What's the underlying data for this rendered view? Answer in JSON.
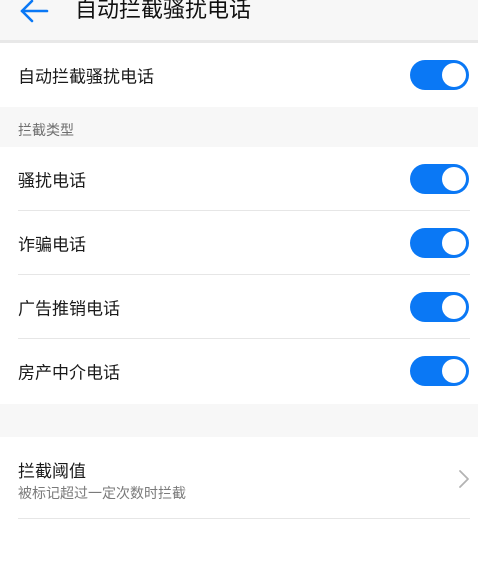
{
  "header": {
    "title": "自动拦截骚扰电话",
    "back_icon": "arrow-left-icon"
  },
  "colors": {
    "accent": "#0a78f5",
    "background": "#f7f7f7",
    "card": "#ffffff",
    "secondary_text": "#7a7a7a"
  },
  "main_toggle": {
    "label": "自动拦截骚扰电话",
    "on": true
  },
  "block_types": {
    "section_label": "拦截类型",
    "items": [
      {
        "label": "骚扰电话",
        "on": true
      },
      {
        "label": "诈骗电话",
        "on": true
      },
      {
        "label": "广告推销电话",
        "on": true
      },
      {
        "label": "房产中介电话",
        "on": true
      }
    ]
  },
  "threshold": {
    "title": "拦截阈值",
    "subtitle": "被标记超过一定次数时拦截",
    "icon": "chevron-right-icon"
  }
}
